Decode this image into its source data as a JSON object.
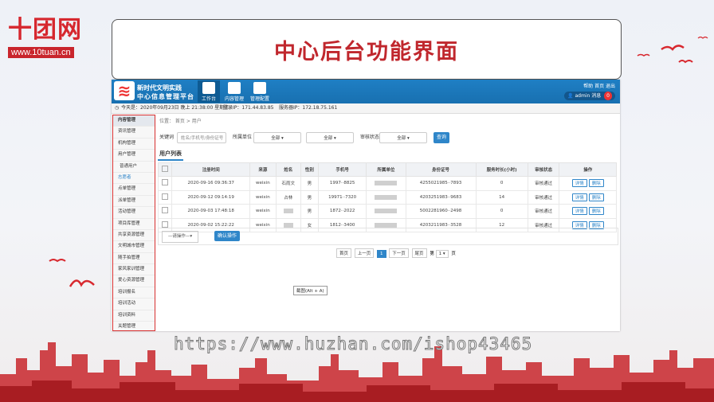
{
  "brand": {
    "name": "十团网",
    "url": "www.10tuan.cn"
  },
  "slide_title": "中心后台功能界面",
  "watermark": "https://www.huzhan.com/ishop43465",
  "app": {
    "logo_line1": "新时代文明实践",
    "logo_line2": "中心信息管理平台",
    "nav_tabs": [
      {
        "label": "工作台",
        "active": true
      },
      {
        "label": "内容管理",
        "active": false
      },
      {
        "label": "管理配置",
        "active": false
      }
    ],
    "top_links": "帮助  首页  退出",
    "user": {
      "name": "admin",
      "msg_label": "消息",
      "msg_count": "0"
    },
    "info": {
      "today": "今天是：2020年09月23日 晚上 21:38:00 星期三",
      "login_ip": "登录IP：171.44.83.85",
      "server_ip": "服务器IP：172.18.75.161"
    }
  },
  "sidebar": {
    "items": [
      {
        "label": "内容管理",
        "kind": "head"
      },
      {
        "label": "资讯管理",
        "kind": "item"
      },
      {
        "label": "机构管理",
        "kind": "item"
      },
      {
        "label": "用户管理",
        "kind": "active"
      },
      {
        "label": "普通用户",
        "kind": "sub"
      },
      {
        "label": "志愿者",
        "kind": "cur"
      },
      {
        "label": "点单管理",
        "kind": "item"
      },
      {
        "label": "派单管理",
        "kind": "item"
      },
      {
        "label": "活动管理",
        "kind": "item"
      },
      {
        "label": "项目库管理",
        "kind": "item"
      },
      {
        "label": "共享资源管理",
        "kind": "item"
      },
      {
        "label": "文明城市管理",
        "kind": "item"
      },
      {
        "label": "随手拍管理",
        "kind": "item"
      },
      {
        "label": "家风家训管理",
        "kind": "item"
      },
      {
        "label": "爱心资源管理",
        "kind": "item"
      },
      {
        "label": "培训报名",
        "kind": "item"
      },
      {
        "label": "培训活动",
        "kind": "item"
      },
      {
        "label": "培训资料",
        "kind": "item"
      },
      {
        "label": "关题管理",
        "kind": "item"
      }
    ]
  },
  "main": {
    "breadcrumb": "位置： 首页 > 用户",
    "filters": {
      "keyword_label": "关键词",
      "keyword_placeholder": "姓名/手机号/身份证号",
      "unit_label": "所属单位",
      "select_all_1": "全部 ▾",
      "select_all_2": "全部 ▾",
      "status_label": "审核状态",
      "select_all_3": "全部 ▾",
      "query": "查询"
    },
    "list_title": "用户列表",
    "columns": [
      "",
      "注册时间",
      "来源",
      "姓名",
      "性别",
      "手机号",
      "所属单位",
      "身份证号",
      "服务时长(小时)",
      "审核状态",
      "操作"
    ],
    "rows": [
      {
        "time": "2020-09-16 09:36:37",
        "source": "weixin",
        "name": "石雨文",
        "gender": "男",
        "phone": "1997··8825",
        "id": "42550219⁠85··7893",
        "hours": "0",
        "status": "审核通过"
      },
      {
        "time": "2020-09-12 09:14:19",
        "source": "weixin",
        "name": "占林",
        "gender": "男",
        "phone": "19971··7320",
        "id": "42032519⁠83··9683",
        "hours": "14",
        "status": "审核通过"
      },
      {
        "time": "2020-09-03 17:48:18",
        "source": "weixin",
        "name": "",
        "gender": "男",
        "phone": "1872··2022",
        "id": "50022819⁠60··2498",
        "hours": "0",
        "status": "审核通过"
      },
      {
        "time": "2020-09-02 15:22:22",
        "source": "weixin",
        "name": "",
        "gender": "女",
        "phone": "1812··3400",
        "id": "42032119⁠83··3528",
        "hours": "12",
        "status": "审核通过"
      }
    ],
    "op_detail": "详情",
    "op_delete": "删除",
    "batch_select": "—请操作—▾",
    "batch_confirm": "确认操作",
    "pager": {
      "first": "首页",
      "prev": "上一页",
      "current": "1",
      "next": "下一页",
      "last": "尾页",
      "jump_pre": "第",
      "jump_val": "1 ▾",
      "jump_post": "页"
    },
    "tooltip": "截图(Alt + A)"
  },
  "colors": {
    "accent": "#2f86c9",
    "brand_red": "#d6272e",
    "topbar": "#1f7fc4"
  }
}
